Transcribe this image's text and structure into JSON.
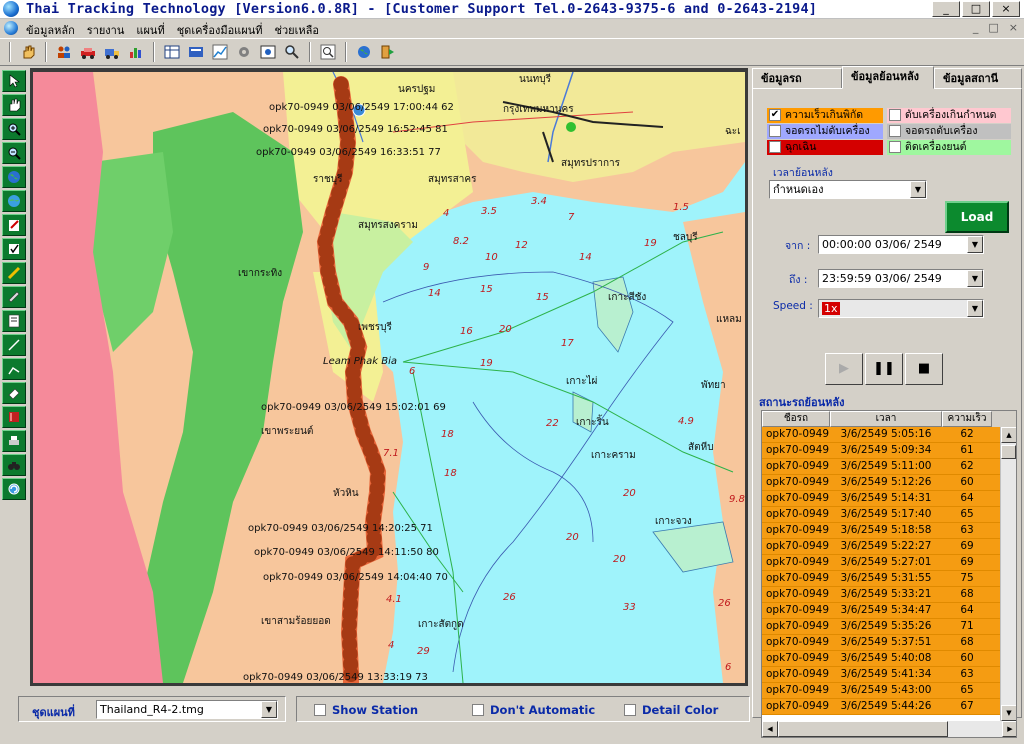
{
  "window": {
    "title": "Thai Tracking Technology [Version6.0.8R] - [Customer Support Tel.0-2643-9375-6 and 0-2643-2194]",
    "buttons": [
      "_",
      "□",
      "×"
    ]
  },
  "menu": {
    "items": [
      "ข้อมูลหลัก",
      "รายงาน",
      "แผนที่",
      "ชุดเครื่องมือแผนที่",
      "ช่วยเหลือ"
    ],
    "mdi_buttons": [
      "_",
      "□",
      "×"
    ]
  },
  "toolbar_icons": [
    "hand-icon",
    "people-icon",
    "car-icon",
    "truck-icon",
    "chart-icon",
    "table-icon",
    "card-icon",
    "graph-icon",
    "gear-icon",
    "image-icon",
    "search-icon",
    "zoom-icon",
    "globe-icon",
    "exit-icon"
  ],
  "left_tools": [
    "pointer-icon",
    "pan-icon",
    "zoom-in-icon",
    "zoom-out-icon",
    "globe-icon",
    "world-icon",
    "edit-icon",
    "check-icon",
    "pencil-icon",
    "ruler-icon",
    "note-icon",
    "line-icon",
    "measure-icon",
    "eraser-icon",
    "book-icon",
    "print-icon",
    "binocular-icon",
    "refresh-icon"
  ],
  "map": {
    "cities": [
      {
        "name": "นนทบุรี"
      },
      {
        "name": "นครปฐม"
      },
      {
        "name": "กรุงเทพมหานคร"
      },
      {
        "name": "สมุทรปราการ"
      },
      {
        "name": "สมุทรสาคร"
      },
      {
        "name": "ราชบุรี"
      },
      {
        "name": "สมุทรสงคราม"
      },
      {
        "name": "ชลบุรี"
      },
      {
        "name": "เขากระทิง"
      },
      {
        "name": "เพชรบุรี"
      },
      {
        "name": "Leam Phak Bia"
      },
      {
        "name": "เกาะสีชัง"
      },
      {
        "name": "แหลม"
      },
      {
        "name": "เกาะไผ่"
      },
      {
        "name": "พัทยา"
      },
      {
        "name": "เกาะริ้น"
      },
      {
        "name": "เขาพระยนต์"
      },
      {
        "name": "สัตหีบ"
      },
      {
        "name": "เกาะคราม"
      },
      {
        "name": "หัวหิน"
      },
      {
        "name": "เกาะจวง"
      },
      {
        "name": "เขาสามร้อยยอด"
      },
      {
        "name": "เกาะสัตกูด"
      },
      {
        "name": "ฉะเ"
      }
    ],
    "soundings": [
      "4",
      "3.5",
      "3.4",
      "7",
      "1.5",
      "8.2",
      "10",
      "12",
      "14",
      "19",
      "9",
      "15",
      "15",
      "14",
      "16",
      "20",
      "17",
      "6",
      "19",
      "22",
      "4.9",
      "18",
      "7.1",
      "18",
      "20",
      "9.8",
      "20",
      "20",
      "26",
      "33",
      "4.1",
      "26",
      "4",
      "29",
      "6"
    ],
    "track_labels": [
      "opk70-0949  03/06/2549  17:00:44  62",
      "opk70-0949  03/06/2549  16:52:45  81",
      "opk70-0949  03/06/2549  16:33:51  77",
      "opk70-0949  03/06/2549  15:02:01  69",
      "opk70-0949  03/06/2549  14:20:25  71",
      "opk70-0949  03/06/2549  14:11:50  80",
      "opk70-0949  03/06/2549  14:04:40  70",
      "opk70-0949  03/06/2549  13:33:19  73"
    ]
  },
  "tabs": [
    "ข้อมูลรถ",
    "ข้อมูลย้อนหลัง",
    "ข้อมูลสถานี"
  ],
  "filters": [
    {
      "label": "ความเร็วเกินพิกัด",
      "checked": true,
      "color": "#ff9a00"
    },
    {
      "label": "ดับเครื่องเกินกำหนด",
      "checked": false,
      "color": "#ffc8d0"
    },
    {
      "label": "จอดรถไม่ดับเครื่อง",
      "checked": false,
      "color": "#9fa8ff"
    },
    {
      "label": "จอดรถดับเครื่อง",
      "checked": false,
      "color": "#c0c0c0"
    },
    {
      "label": "ฉุกเฉิน",
      "checked": false,
      "color": "#d40000"
    },
    {
      "label": "ติดเครื่องยนต์",
      "checked": false,
      "color": "#9ff79f"
    }
  ],
  "history": {
    "time_label": "เวลาย้อนหลัง",
    "time_value": "กำหนดเอง",
    "load_label": "Load",
    "from_label": "จาก :",
    "from_value": "00:00:00 03/06/ 2549",
    "to_label": "ถึง :",
    "to_value": "23:59:59 03/06/ 2549",
    "speed_label": "Speed :",
    "speed_value": "1x",
    "controls": [
      "play-icon",
      "pause-icon",
      "stop-icon"
    ]
  },
  "status": {
    "title": "สถานะรถย้อนหลัง",
    "columns": [
      "ชื่อรถ",
      "เวลา",
      "ความเร็ว"
    ],
    "rows": [
      [
        "opk70-0949",
        "3/6/2549 5:05:16",
        "62"
      ],
      [
        "opk70-0949",
        "3/6/2549 5:09:34",
        "61"
      ],
      [
        "opk70-0949",
        "3/6/2549 5:11:00",
        "62"
      ],
      [
        "opk70-0949",
        "3/6/2549 5:12:26",
        "60"
      ],
      [
        "opk70-0949",
        "3/6/2549 5:14:31",
        "64"
      ],
      [
        "opk70-0949",
        "3/6/2549 5:17:40",
        "65"
      ],
      [
        "opk70-0949",
        "3/6/2549 5:18:58",
        "63"
      ],
      [
        "opk70-0949",
        "3/6/2549 5:22:27",
        "69"
      ],
      [
        "opk70-0949",
        "3/6/2549 5:27:01",
        "69"
      ],
      [
        "opk70-0949",
        "3/6/2549 5:31:55",
        "75"
      ],
      [
        "opk70-0949",
        "3/6/2549 5:33:21",
        "68"
      ],
      [
        "opk70-0949",
        "3/6/2549 5:34:47",
        "64"
      ],
      [
        "opk70-0949",
        "3/6/2549 5:35:26",
        "71"
      ],
      [
        "opk70-0949",
        "3/6/2549 5:37:51",
        "68"
      ],
      [
        "opk70-0949",
        "3/6/2549 5:40:08",
        "60"
      ],
      [
        "opk70-0949",
        "3/6/2549 5:41:34",
        "63"
      ],
      [
        "opk70-0949",
        "3/6/2549 5:43:00",
        "65"
      ],
      [
        "opk70-0949",
        "3/6/2549 5:44:26",
        "67"
      ]
    ]
  },
  "bottom": {
    "map_set_label": "ชุดแผนที่",
    "map_set_value": "Thailand_R4-2.tmg",
    "show_station": "Show Station",
    "dont_automatic": "Don't Automatic",
    "detail_color": "Detail Color"
  },
  "colors": {
    "accent": "#0a2aa8",
    "title": "#0a1a8c",
    "green": "#0c7a2e",
    "row": "#f59c12",
    "track": "#e8673a"
  }
}
